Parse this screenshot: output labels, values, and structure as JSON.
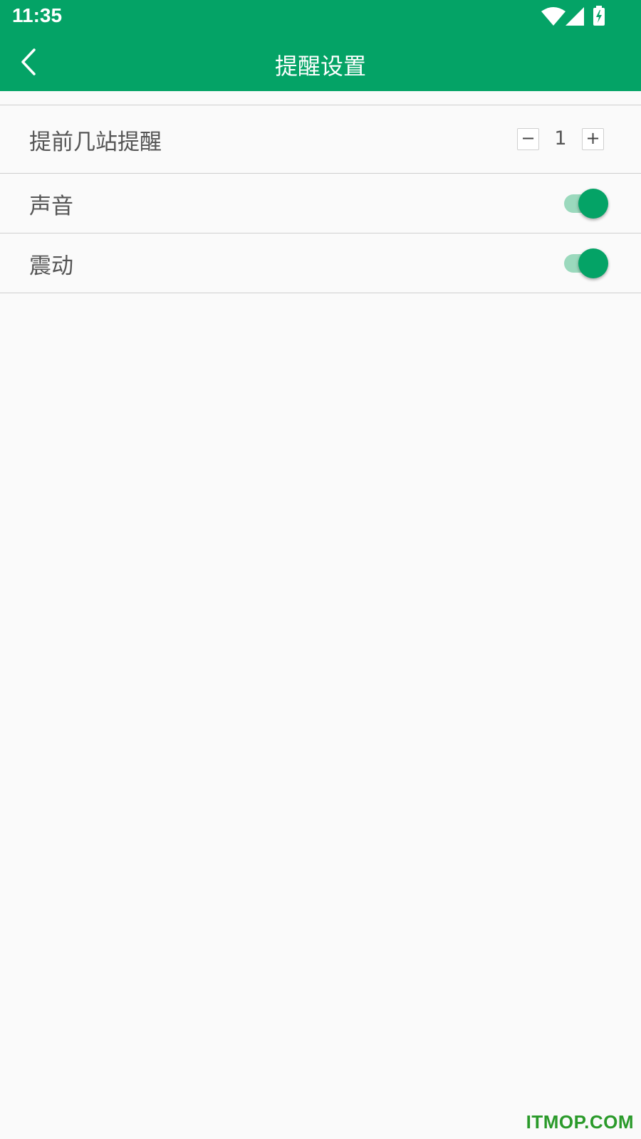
{
  "status_bar": {
    "time": "11:35",
    "icons": [
      "wifi-icon",
      "signal-icon",
      "battery-charging-icon"
    ]
  },
  "header": {
    "title": "提醒设置",
    "back_icon": "chevron-left-icon"
  },
  "settings": {
    "stations_ahead": {
      "label": "提前几站提醒",
      "value": "1",
      "minus": "−",
      "plus": "+"
    },
    "sound": {
      "label": "声音",
      "enabled": true
    },
    "vibration": {
      "label": "震动",
      "enabled": true
    }
  },
  "watermark": "ITMOP.COM",
  "colors": {
    "primary": "#04a366",
    "track_on": "#9bd9bd",
    "background": "#fafafa",
    "divider": "#cfcfcf",
    "label_text": "#555555"
  }
}
